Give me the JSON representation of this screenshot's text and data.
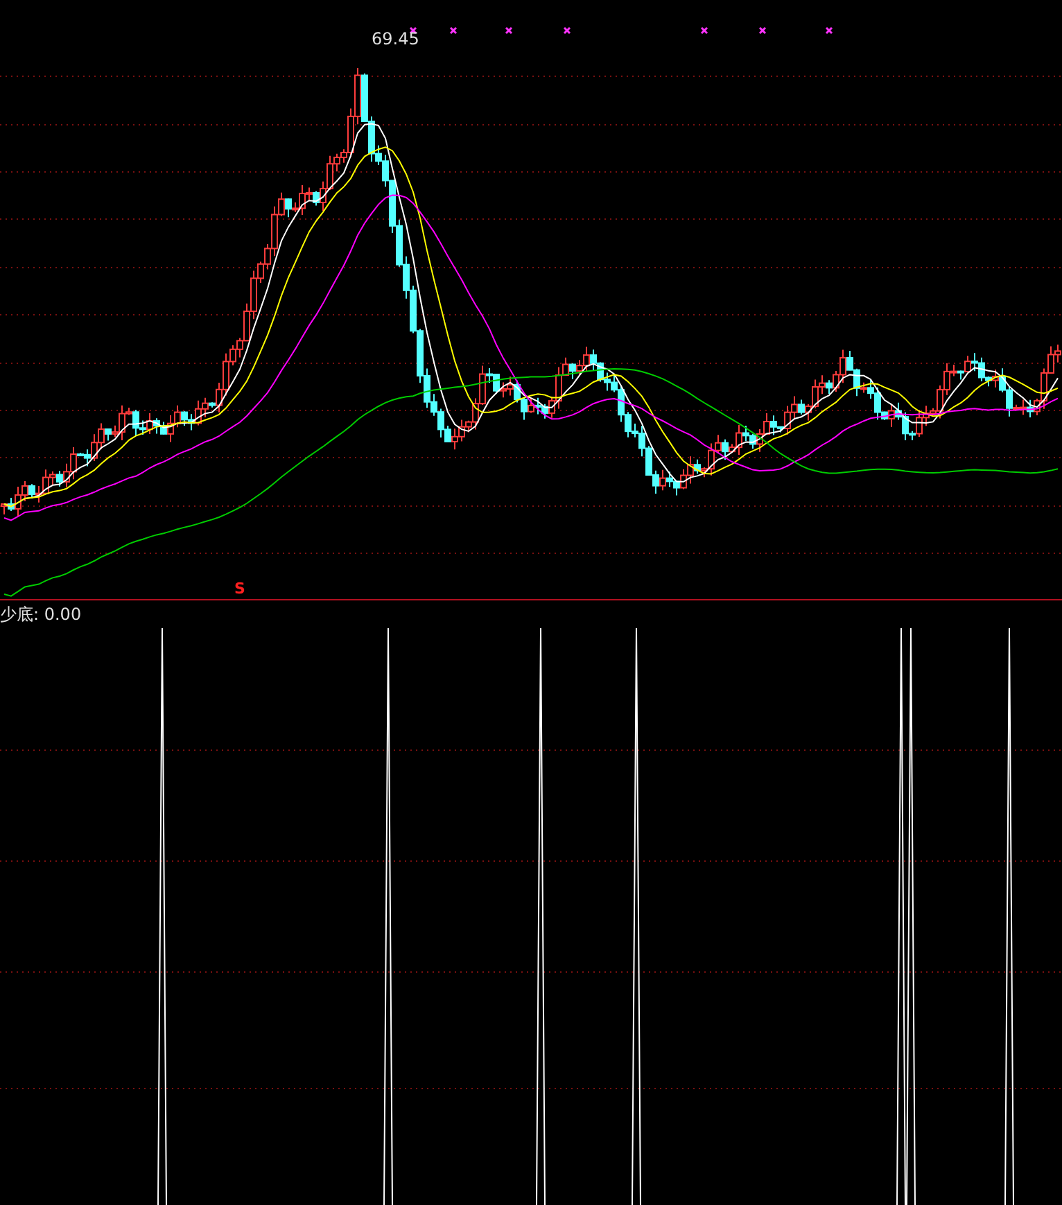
{
  "price_panel": {
    "high_label": "69.45",
    "signal_mark": "S"
  },
  "indicator_panel": {
    "label": "少底: 0.00"
  }
}
